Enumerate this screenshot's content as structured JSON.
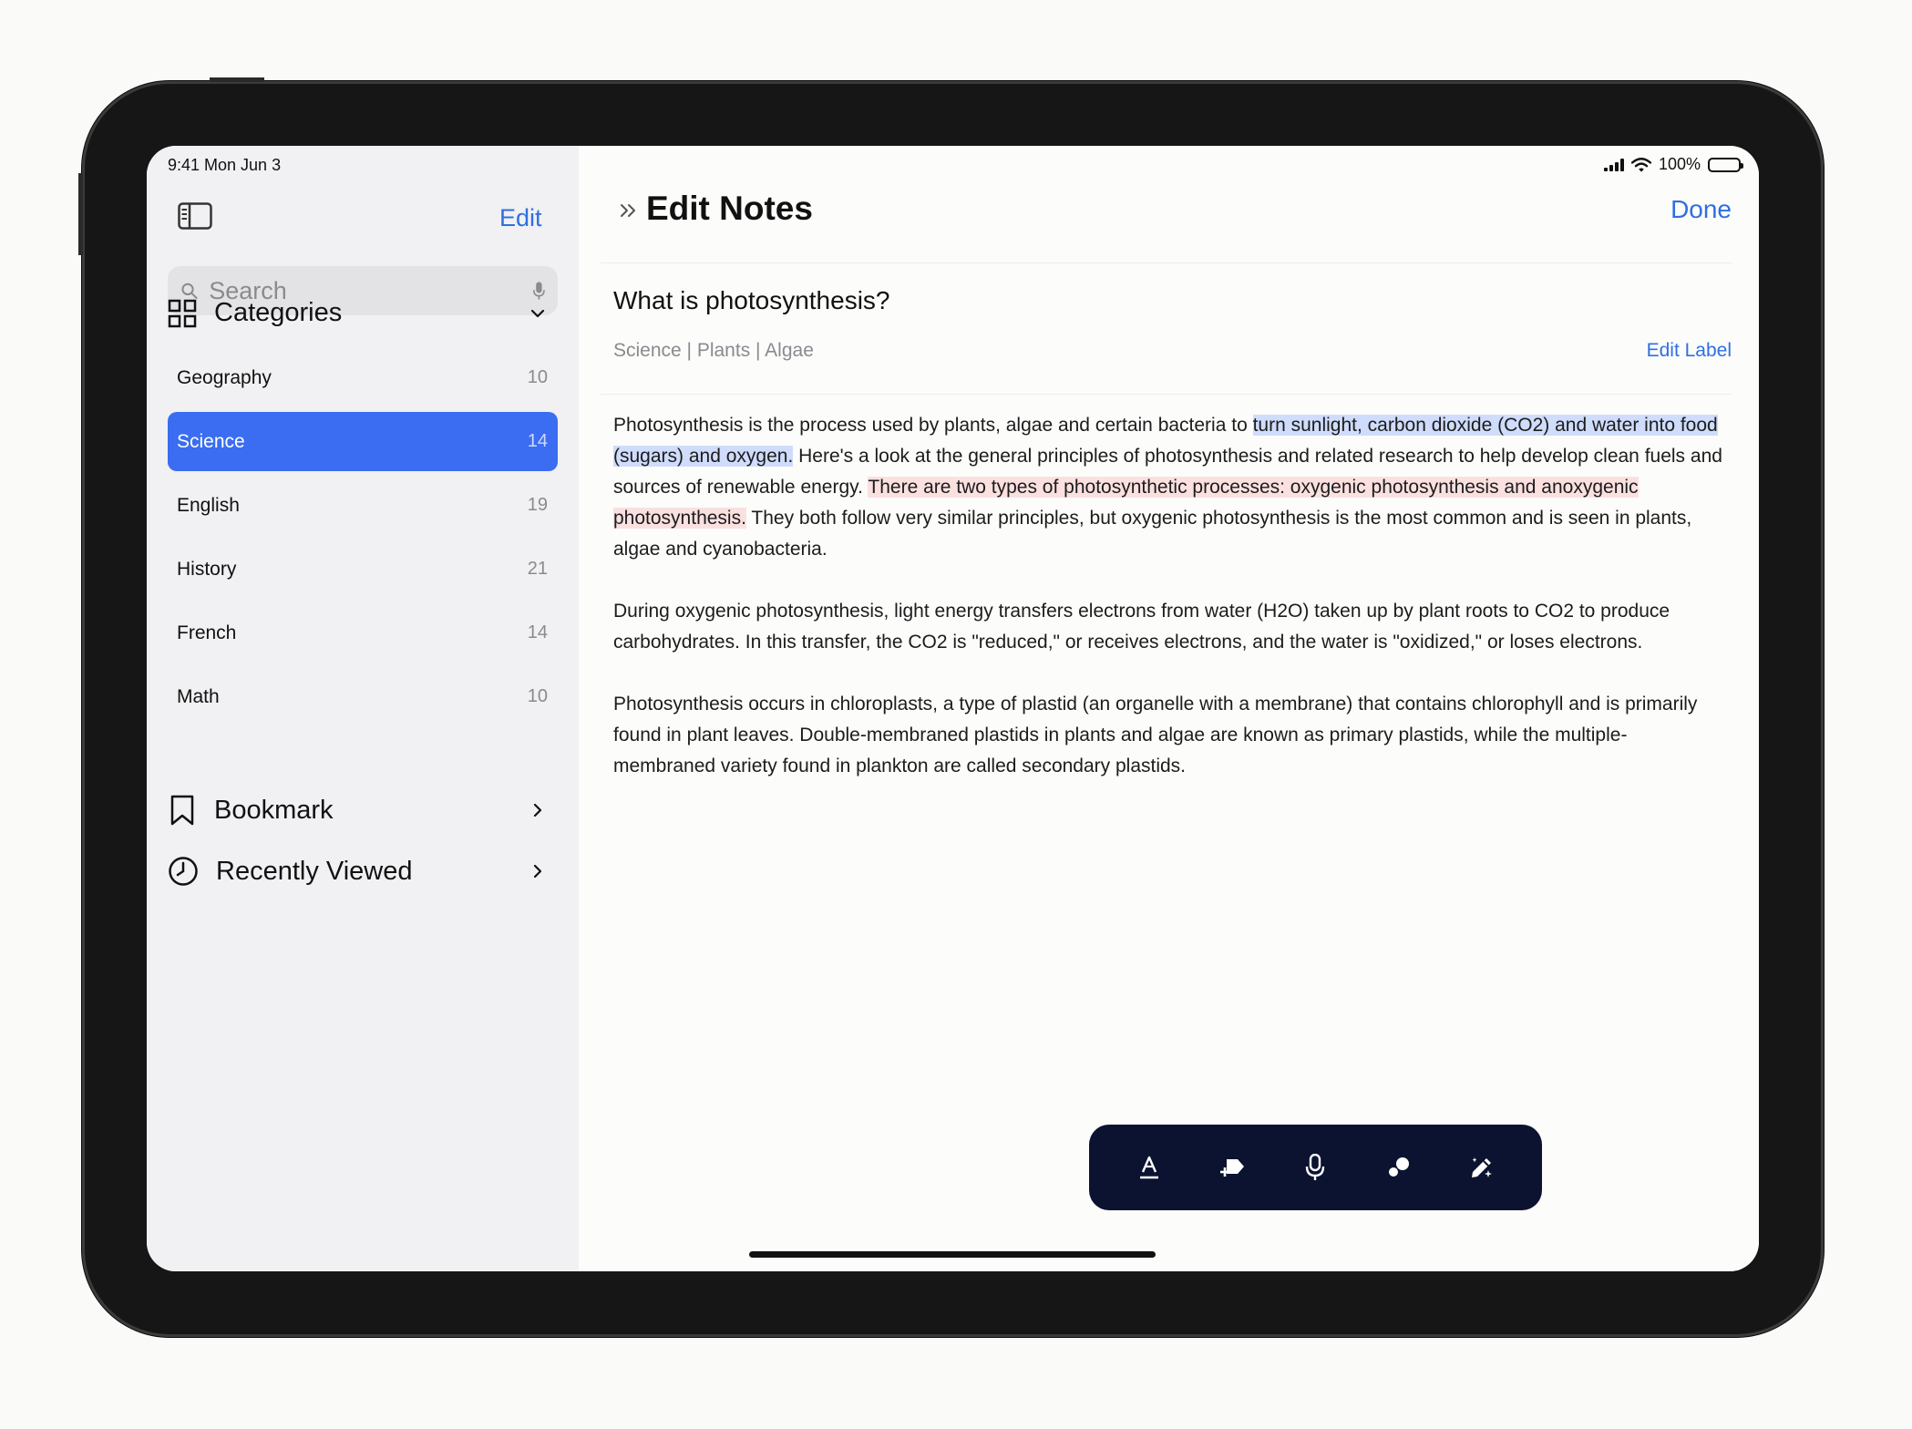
{
  "status_bar": {
    "time": "9:41  Mon Jun 3",
    "battery": "100%"
  },
  "sidebar": {
    "edit_label": "Edit",
    "search": {
      "placeholder": "Search"
    },
    "categories_label": "Categories",
    "categories": [
      {
        "name": "Geography",
        "count": "10"
      },
      {
        "name": "Science",
        "count": "14"
      },
      {
        "name": "English",
        "count": "19"
      },
      {
        "name": "History",
        "count": "21"
      },
      {
        "name": "French",
        "count": "14"
      },
      {
        "name": "Math",
        "count": "10"
      }
    ],
    "bookmark_label": "Bookmark",
    "recent_label": "Recently Viewed"
  },
  "main": {
    "title": "Edit Notes",
    "done_label": "Done",
    "note_title": "What is photosynthesis?",
    "labels": "Science | Plants | Algae",
    "edit_label": "Edit Label",
    "p1": {
      "a": "Photosynthesis is the process used by plants, algae and certain bacteria to ",
      "b": "turn sunlight, carbon dioxide (CO2) and water into food (sugars) and oxygen.",
      "c": " Here's a look at the general principles of photosynthesis and related research to help develop clean fuels and sources of renewable energy. ",
      "d": "There are two types of photosynthetic processes: oxygenic photosynthesis and anoxygenic photosynthesis.",
      "e": " They both follow very similar principles, but oxygenic photosynthesis is the most common and is seen in plants, algae and cyanobacteria."
    },
    "p2": "During oxygenic photosynthesis, light energy transfers electrons from water (H2O) taken up by plant roots to CO2 to produce carbohydrates. In this transfer, the CO2 is \"reduced,\" or receives electrons, and the water is \"oxidized,\" or loses electrons.",
    "p3": "Photosynthesis occurs in chloroplasts, a type of plastid (an organelle with a membrane) that contains chlorophyll and is primarily found in plant leaves. Double-membraned plastids in plants and algae are known as primary plastids, while the multiple-membraned variety found in plankton are called secondary plastids."
  },
  "toolbar": {
    "icons": [
      "text-format-icon",
      "add-tag-icon",
      "microphone-icon",
      "shapes-icon",
      "magic-pen-icon"
    ]
  },
  "colors": {
    "accent": "#3a6df2",
    "link": "#2f6fe0",
    "highlight_blue": "#cfdcfb",
    "highlight_red": "#fbe0e0",
    "toolbar_bg": "#0b1330"
  }
}
